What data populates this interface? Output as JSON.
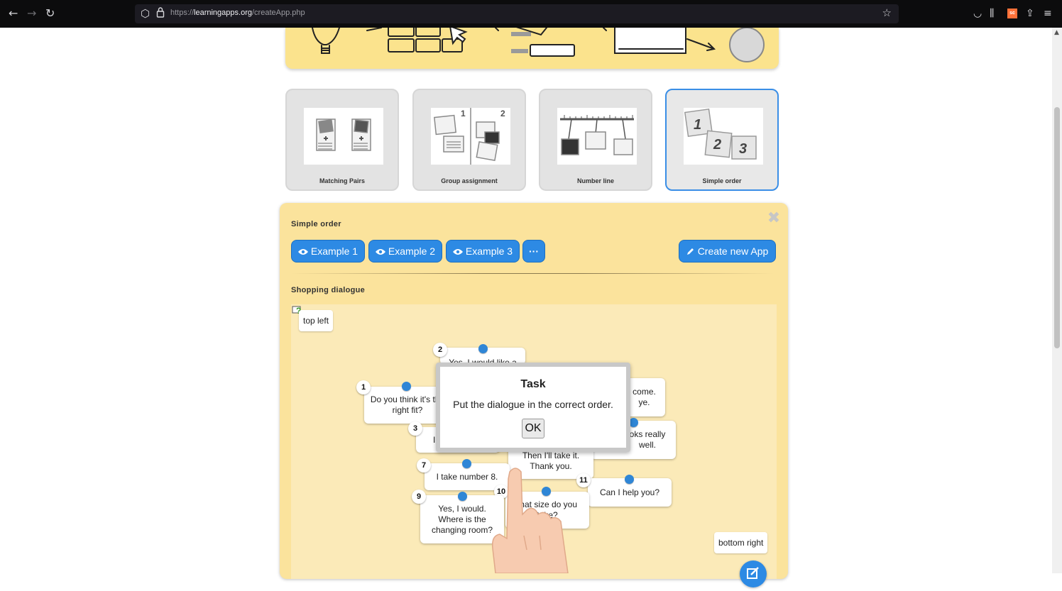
{
  "browser": {
    "url_prefix": "https://",
    "url_domain": "learningapps.org",
    "url_path": "/createApp.php",
    "back_icon": "back-arrow-icon",
    "forward_icon": "forward-arrow-icon",
    "reload_icon": "reload-icon",
    "extension_badge": "sc"
  },
  "templates": [
    {
      "label": "Matching Pairs",
      "selected": false
    },
    {
      "label": "Group assignment",
      "selected": false
    },
    {
      "label": "Number line",
      "selected": false
    },
    {
      "label": "Simple order",
      "selected": true
    }
  ],
  "panel": {
    "title": "Simple order",
    "examples": [
      "Example 1",
      "Example 2",
      "Example 3"
    ],
    "more_label": "···",
    "create_label": "Create new App",
    "subtitle": "Shopping dialogue"
  },
  "game": {
    "top_left": "top left",
    "bottom_right": "bottom right",
    "cards": [
      {
        "num": "2",
        "text": "Yes, I would like a"
      },
      {
        "num": "1",
        "text": "Do you think it's the right fit?"
      },
      {
        "num": "",
        "text": "come. ye."
      },
      {
        "num": "3",
        "text": "I"
      },
      {
        "num": "",
        "text": "oks really well."
      },
      {
        "num": "",
        "text": "Then I'll take it. Thank you."
      },
      {
        "num": "7",
        "text": "I take number 8."
      },
      {
        "num": "11",
        "text": "Can I help you?"
      },
      {
        "num": "10",
        "text": "/hat size do you take?"
      },
      {
        "num": "9",
        "text": "Yes, I would. Where is the changing room?"
      }
    ]
  },
  "task": {
    "title": "Task",
    "text": "Put the dialogue in the correct order.",
    "ok": "OK"
  },
  "colors": {
    "accent": "#2d8ae4",
    "panel": "#fbe39c",
    "hero": "#fbe38d"
  }
}
